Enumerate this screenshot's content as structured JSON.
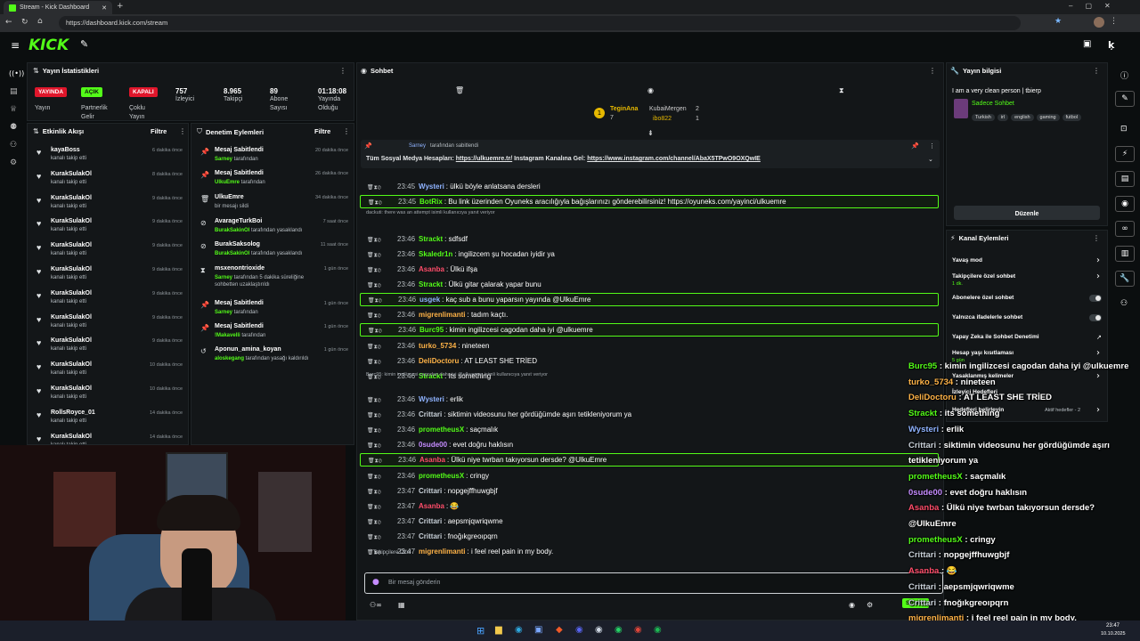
{
  "browser": {
    "tab_title": "Stream - Kick Dashboard",
    "url": "https://dashboard.kick.com/stream"
  },
  "brand": {
    "logo": "KICK",
    "logo_icon": "kick-logo",
    "accent": "#53fc18"
  },
  "stats_panel": {
    "title": "Yayın İstatistikleri",
    "badges": [
      {
        "label": "YAYINDA",
        "color": "#e0162b"
      },
      {
        "label": "AÇIK",
        "color": "#53fc18"
      },
      {
        "label": "KAPALI",
        "color": "#e0162b"
      }
    ],
    "badge_captions": [
      "Yayın",
      "Partnerlik Gelir",
      "Çoklu Yayın"
    ],
    "stats": [
      {
        "value": "757",
        "label": "İzleyici"
      },
      {
        "value": "8.965",
        "label": "Takipçi"
      },
      {
        "value": "89",
        "label": "Abone Sayısı"
      },
      {
        "value": "01:18:08",
        "label": "Yayında Olduğu"
      }
    ]
  },
  "activity_feed": {
    "title": "Etkinlik Akışı",
    "filter_label": "Filtre",
    "items": [
      {
        "name": "kayaBoss",
        "sub": "kanalı takip etti",
        "time": "6 dakika önce"
      },
      {
        "name": "KurakSulakOl",
        "sub": "kanalı takip etti",
        "time": "8 dakika önce"
      },
      {
        "name": "KurakSulakOl",
        "sub": "kanalı takip etti",
        "time": "9 dakika önce"
      },
      {
        "name": "KurakSulakOl",
        "sub": "kanalı takip etti",
        "time": "9 dakika önce"
      },
      {
        "name": "KurakSulakOl",
        "sub": "kanalı takip etti",
        "time": "9 dakika önce"
      },
      {
        "name": "KurakSulakOl",
        "sub": "kanalı takip etti",
        "time": "9 dakika önce"
      },
      {
        "name": "KurakSulakOl",
        "sub": "kanalı takip etti",
        "time": "9 dakika önce"
      },
      {
        "name": "KurakSulakOl",
        "sub": "kanalı takip etti",
        "time": "9 dakika önce"
      },
      {
        "name": "KurakSulakOl",
        "sub": "kanalı takip etti",
        "time": "9 dakika önce"
      },
      {
        "name": "KurakSulakOl",
        "sub": "kanalı takip etti",
        "time": "10 dakika önce"
      },
      {
        "name": "KurakSulakOl",
        "sub": "kanalı takip etti",
        "time": "10 dakika önce"
      },
      {
        "name": "RollsRoyce_01",
        "sub": "kanalı takip etti",
        "time": "14 dakika önce"
      },
      {
        "name": "KurakSulakOl",
        "sub": "kanalı takip etti",
        "time": "14 dakika önce"
      }
    ]
  },
  "mod_actions": {
    "title": "Denetim Eylemleri",
    "filter_label": "Filtre",
    "items": [
      {
        "icon": "pin-icon",
        "title": "Mesaj Sabitlendi",
        "actor": "Sarney",
        "rest": " tarafından",
        "time": "20 dakika önce"
      },
      {
        "icon": "pin-icon",
        "title": "Mesaj Sabitlendi",
        "actor": "UlkuEmre",
        "rest": " tarafından",
        "time": "26 dakika önce"
      },
      {
        "icon": "trash-icon",
        "title": "UlkuEmre",
        "actor": "",
        "rest": "bir mesajı sildi",
        "time": "34 dakika önce"
      },
      {
        "icon": "ban-icon",
        "title": "AvarageTurkBoi",
        "actor": "BurakSakinOl",
        "rest": " tarafından yasaklandı",
        "time": "7 saat önce"
      },
      {
        "icon": "ban-icon",
        "title": "BurakSaksolog",
        "actor": "BurakSakinOl",
        "rest": " tarafından yasaklandı",
        "time": "11 saat önce"
      },
      {
        "icon": "hourglass-icon",
        "title": "msxenontrioxide",
        "actor": "Sarney",
        "rest": " tarafından 5 dakika süreliğine sohbetten uzaklaştırıldı",
        "time": "1 gün önce"
      },
      {
        "icon": "pin-icon",
        "title": "Mesaj Sabitlendi",
        "actor": "Sarney",
        "rest": " tarafından",
        "time": "1 gün önce"
      },
      {
        "icon": "pin-icon",
        "title": "Mesaj Sabitlendi",
        "actor": "!Makavelli",
        "rest": " tarafından",
        "time": "1 gün önce"
      },
      {
        "icon": "unban-icon",
        "title": "Aponun_amina_koyan",
        "actor": "aloskegang",
        "rest": " tarafından yasağı kaldırıldı",
        "time": "1 gün önce"
      }
    ]
  },
  "chat": {
    "title": "Sohbet",
    "leaderboard": [
      {
        "name": "TeginAna",
        "count": "7"
      },
      {
        "name": "KubaiMergen",
        "count": "2"
      },
      {
        "name": "ibo822",
        "count": "1"
      }
    ],
    "pinned": {
      "by": "Sarney",
      "by_suffix": "tarafından sabitlendi",
      "text_prefix": "Tüm Sosyal Medya Hesapları: ",
      "link1": "https://ulkuemre.tr/",
      "text_mid": " Instagram Kanalına Gel: ",
      "link2": "https://www.instagram.com/channel/AbaX5TPwO9OXQwIE"
    },
    "messages": [
      {
        "time": "23:45",
        "user": "Wysteri",
        "color": "#8fb3ff",
        "text": "ülkü böyle anlatsana dersleri",
        "hl": false
      },
      {
        "time": "23:45",
        "user": "BotRix",
        "color": "#53fc18",
        "text": "Bu link üzerinden Oyuneks aracılığıyla bağışlarınızı gönderebilirsiniz! https://oyuneks.com/yayinci/ulkuemre",
        "hl": true
      },
      {
        "time": "23:46",
        "user": "Strackt",
        "color": "#53fc18",
        "text": "sdfsdf",
        "hl": false
      },
      {
        "time": "23:46",
        "user": "Skaledr1n",
        "color": "#53fc18",
        "text": "ingilizcem şu hocadan iyidir ya",
        "hl": false
      },
      {
        "time": "23:46",
        "user": "Asanba",
        "color": "#ff4d6a",
        "text": "Ülkü ifşa",
        "hl": false
      },
      {
        "time": "23:46",
        "user": "Strackt",
        "color": "#53fc18",
        "text": "Ülkü gitar çalarak yapar bunu",
        "hl": false
      },
      {
        "time": "23:46",
        "user": "usgek",
        "color": "#8fb3ff",
        "text": "kaç sub a bunu yaparsın yayında @UlkuEmre",
        "hl": true
      },
      {
        "time": "23:46",
        "user": "migrenlimanti",
        "color": "#ffb347",
        "text": "tadım kaçtı.",
        "hl": false
      },
      {
        "time": "23:46",
        "user": "Burc95",
        "color": "#53fc18",
        "text": "kimin ingilizcesi cagodan daha iyi @ulkuemre",
        "hl": true
      },
      {
        "time": "23:46",
        "user": "turko_5734",
        "color": "#ffb347",
        "text": "nineteen",
        "hl": false
      },
      {
        "time": "23:46",
        "user": "DeliDoctoru",
        "color": "#ffb347",
        "text": "AT LEAST SHE TRİED",
        "hl": false
      },
      {
        "time": "23:46",
        "user": "Strackt",
        "color": "#53fc18",
        "text": "Its something",
        "hl": false
      },
      {
        "time": "23:46",
        "user": "Wysteri",
        "color": "#8fb3ff",
        "text": "erlik",
        "hl": false
      },
      {
        "time": "23:46",
        "user": "Crittari",
        "color": "#c8d0d8",
        "text": "siktimin videosunu her gördüğümde aşırı tetikleniyorum ya",
        "hl": false
      },
      {
        "time": "23:46",
        "user": "prometheusX",
        "color": "#53fc18",
        "text": "saçmalık",
        "hl": false
      },
      {
        "time": "23:46",
        "user": "0sude00",
        "color": "#c58cff",
        "text": "evet doğru haklısın",
        "hl": false
      },
      {
        "time": "23:46",
        "user": "Asanba",
        "color": "#ff4d6a",
        "text": "Ülkü niye twrban takıyorsun dersde? @UlkuEmre",
        "hl": true
      },
      {
        "time": "23:46",
        "user": "prometheusX",
        "color": "#53fc18",
        "text": "cringy",
        "hl": false
      },
      {
        "time": "23:47",
        "user": "Crittari",
        "color": "#c8d0d8",
        "text": "nopgejffhuwgbjf",
        "hl": false
      },
      {
        "time": "23:47",
        "user": "Asanba",
        "color": "#ff4d6a",
        "text": "😂",
        "hl": false
      },
      {
        "time": "23:47",
        "user": "Crittari",
        "color": "#c8d0d8",
        "text": "aepsmjqwriqwme",
        "hl": false
      },
      {
        "time": "23:47",
        "user": "Crittari",
        "color": "#c8d0d8",
        "text": "fnoğıkgreoıpqrn",
        "hl": false
      },
      {
        "time": "23:47",
        "user": "migrenlimanti",
        "color": "#ffb347",
        "text": "i feel reel pain in my body.",
        "hl": false
      }
    ],
    "notices": [
      "dackuti: there was an attempt isimli kullanıcıya yanıt veriyor",
      "Burc95: kimin ingilizcesi cagodan daha iyi @ulkuemre isimli kullanıcıya yanıt veriyor"
    ],
    "followers_only_label": "Takipçilere Özel",
    "input_placeholder": "Bir mesaj gönderin",
    "send_label": "Sohbet"
  },
  "stream_info": {
    "title": "Yayın bilgisi",
    "stream_title": "I am a very clean person | tbierp",
    "category": "Sadece Sohbet",
    "tags": [
      "Turkish",
      "irl",
      "english",
      "gaming",
      "futbol"
    ],
    "edit_label": "Düzenle"
  },
  "channel_actions": {
    "title": "Kanal Eylemleri",
    "items": [
      {
        "label": "Yavaş mod",
        "sub": "",
        "control": "arrow"
      },
      {
        "label": "Takipçilere özel sohbet",
        "sub": "1 dk.",
        "control": "arrow"
      },
      {
        "label": "Abonelere özel sohbet",
        "sub": "",
        "control": "toggle"
      },
      {
        "label": "Yalnızca ifadelerle sohbet",
        "sub": "",
        "control": "toggle"
      },
      {
        "label": "Yapay Zeka ile Sohbet Denetimi",
        "sub": "",
        "control": "external"
      },
      {
        "label": "Hesap yaşı kısıtlaması",
        "sub": "5 gün",
        "control": "arrow"
      },
      {
        "label": "Yasaklanmış kelimeler",
        "sub": "",
        "control": "arrow"
      },
      {
        "label": "İzleyici Hedefleri",
        "sub": "",
        "control": "none"
      },
      {
        "label": "Hedefleri belirleyin",
        "sub": "Aktif hedefler - 2",
        "control": "arrow"
      }
    ]
  },
  "overlay_chat": [
    {
      "user": "Burc95",
      "color": "#53fc18",
      "text": "kimin ingilizcesi cagodan daha iyi @ulkuemre"
    },
    {
      "user": "turko_5734",
      "color": "#ffb347",
      "text": "nineteen"
    },
    {
      "user": "DeliDoctoru",
      "color": "#ffb347",
      "text": "AT LEAST SHE TRİED"
    },
    {
      "user": "Strackt",
      "color": "#53fc18",
      "text": "its something"
    },
    {
      "user": "Wysteri",
      "color": "#8fb3ff",
      "text": "erlik"
    },
    {
      "user": "Crittari",
      "color": "#c8d0d8",
      "text": "siktimin videosunu her gördüğümde aşırı"
    },
    {
      "user": "",
      "color": "#ffffff",
      "text": "tetikleniyorum ya"
    },
    {
      "user": "prometheusX",
      "color": "#53fc18",
      "text": "saçmalık"
    },
    {
      "user": "0sude00",
      "color": "#c58cff",
      "text": "evet doğru haklısın"
    },
    {
      "user": "Asanba",
      "color": "#ff4d6a",
      "text": "Ülkü niye twrban takıyorsun dersde?"
    },
    {
      "user": "",
      "color": "#ffffff",
      "text": "@UlkuEmre"
    },
    {
      "user": "prometheusX",
      "color": "#53fc18",
      "text": "cringy"
    },
    {
      "user": "Crittari",
      "color": "#c8d0d8",
      "text": "nopgejffhuwgbjf"
    },
    {
      "user": "Asanba",
      "color": "#ff4d6a",
      "text": "😂"
    },
    {
      "user": "Crittari",
      "color": "#c8d0d8",
      "text": "aepsmjqwriqwme"
    },
    {
      "user": "Crittari",
      "color": "#c8d0d8",
      "text": "fnoğıkgreoıpqrn"
    },
    {
      "user": "migrenlimanti",
      "color": "#ffb347",
      "text": "i feel reel pain in my body."
    }
  ],
  "taskbar": {
    "time": "23:47",
    "date": "10.10.2025"
  }
}
